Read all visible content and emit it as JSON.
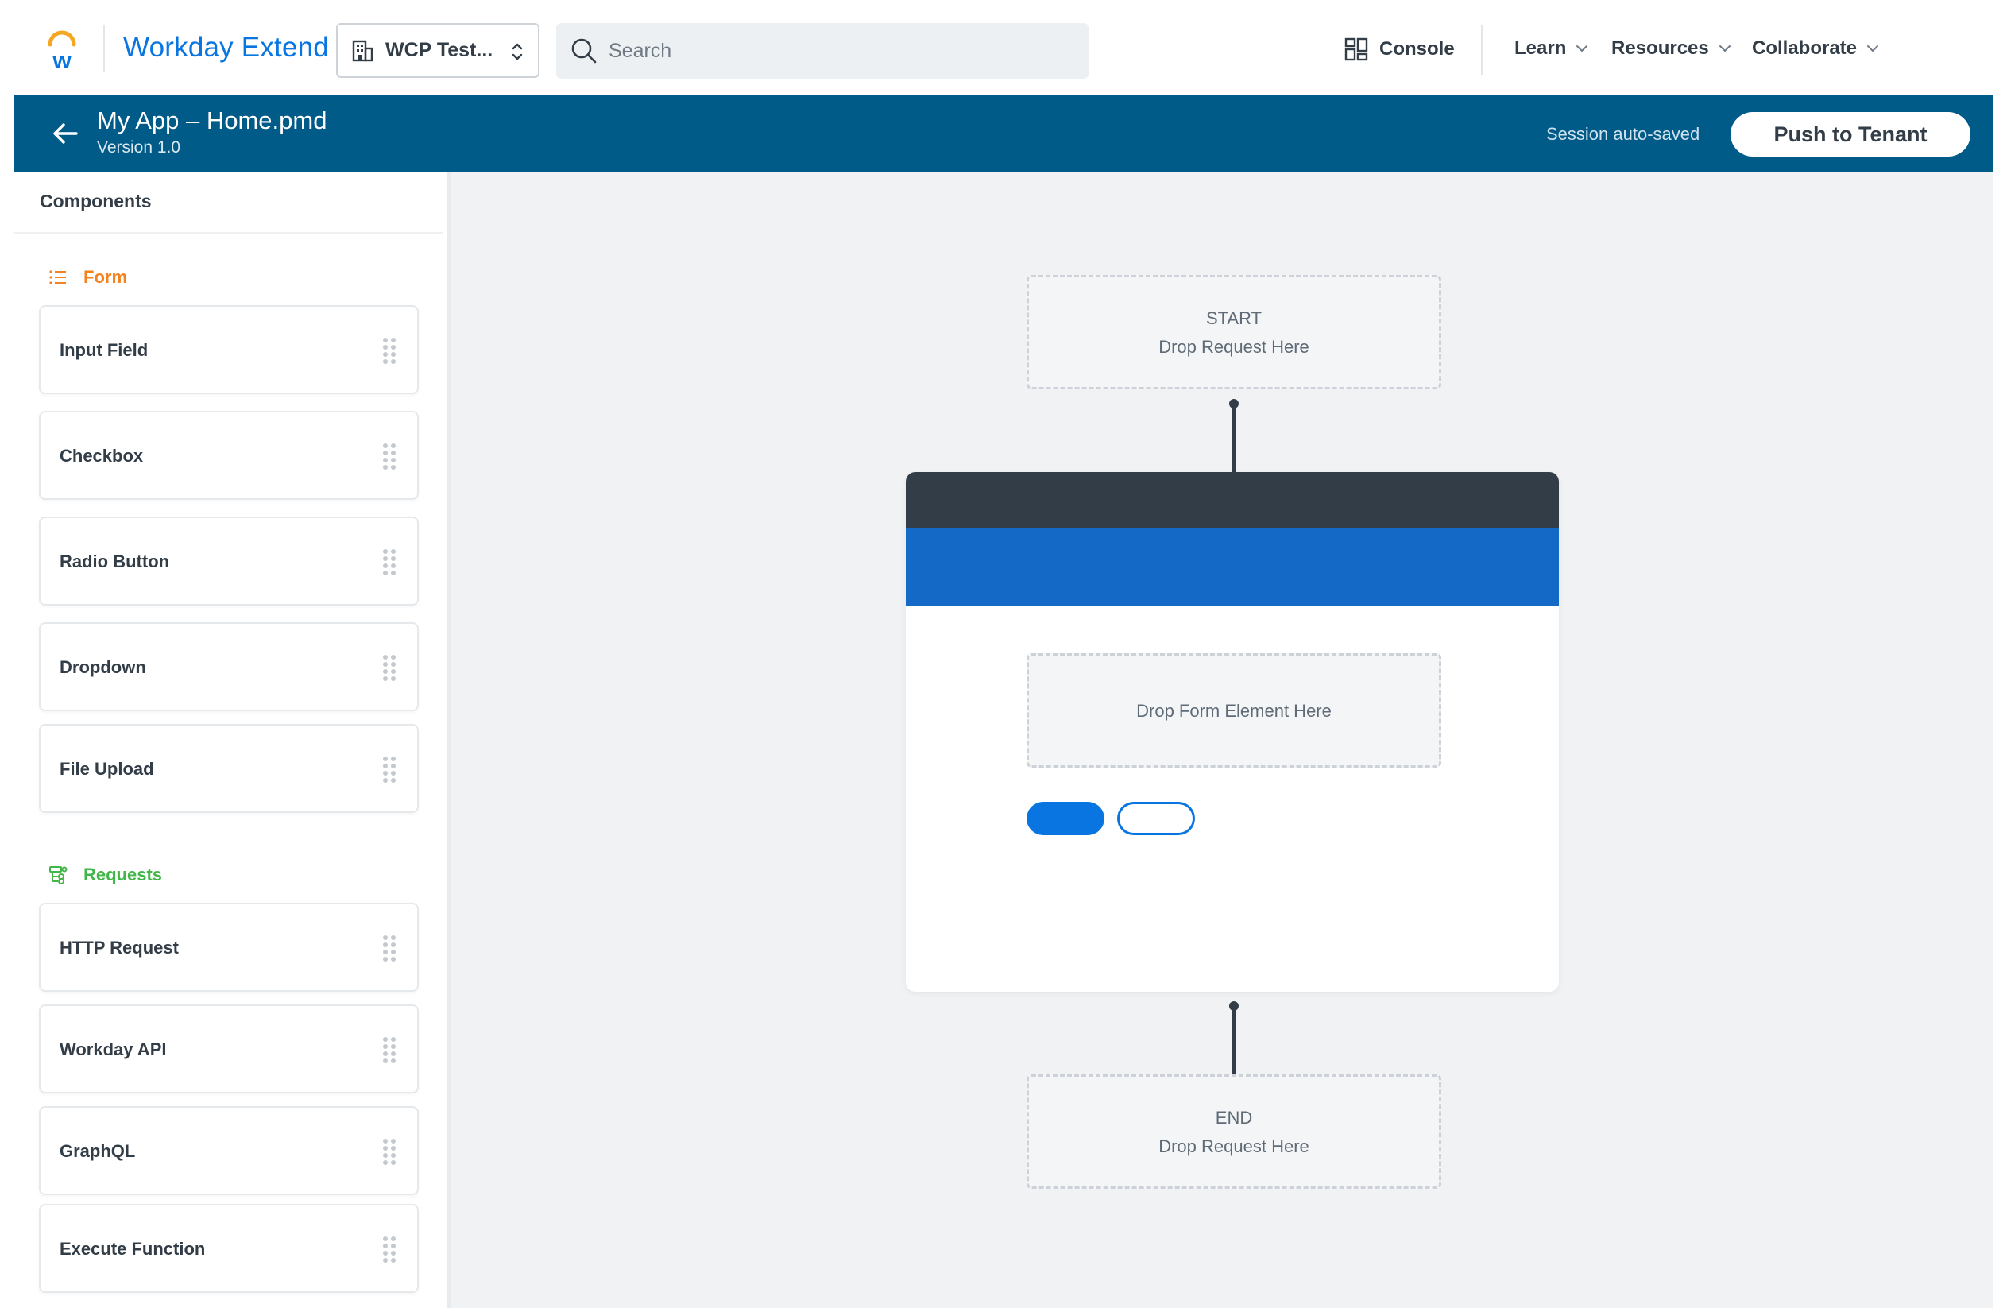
{
  "topbar": {
    "brand": "Workday Extend",
    "tenant": "WCP Test...",
    "search_placeholder": "Search",
    "console_label": "Console",
    "learn_label": "Learn",
    "resources_label": "Resources",
    "collaborate_label": "Collaborate"
  },
  "header": {
    "title": "My App – Home.pmd",
    "version": "Version 1.0",
    "status": "Session auto-saved",
    "push_label": "Push to Tenant"
  },
  "sidebar": {
    "title": "Components",
    "form_section": {
      "label": "Form",
      "items": [
        "Input Field",
        "Checkbox",
        "Radio Button",
        "Dropdown",
        "File Upload"
      ]
    },
    "requests_section": {
      "label": "Requests",
      "items": [
        "HTTP Request",
        "Workday API",
        "GraphQL",
        "Execute Function"
      ]
    }
  },
  "canvas": {
    "start_title": "START",
    "start_hint": "Drop Request Here",
    "form_hint": "Drop Form Element Here",
    "end_title": "END",
    "end_hint": "Drop Request Here"
  },
  "colors": {
    "header_bg": "#005b88",
    "brand_blue": "#0875e1",
    "form_accent": "#f5821f",
    "requests_accent": "#43b649",
    "page_dark": "#333d47",
    "page_blue": "#1468c6"
  },
  "icons": {
    "logo": "workday-logo",
    "tenant": "building-icon",
    "search": "search-icon",
    "console": "grid-icon",
    "back": "arrow-left-icon",
    "form": "list-icon",
    "requests": "flow-icon",
    "drag": "drag-handle-icon"
  }
}
